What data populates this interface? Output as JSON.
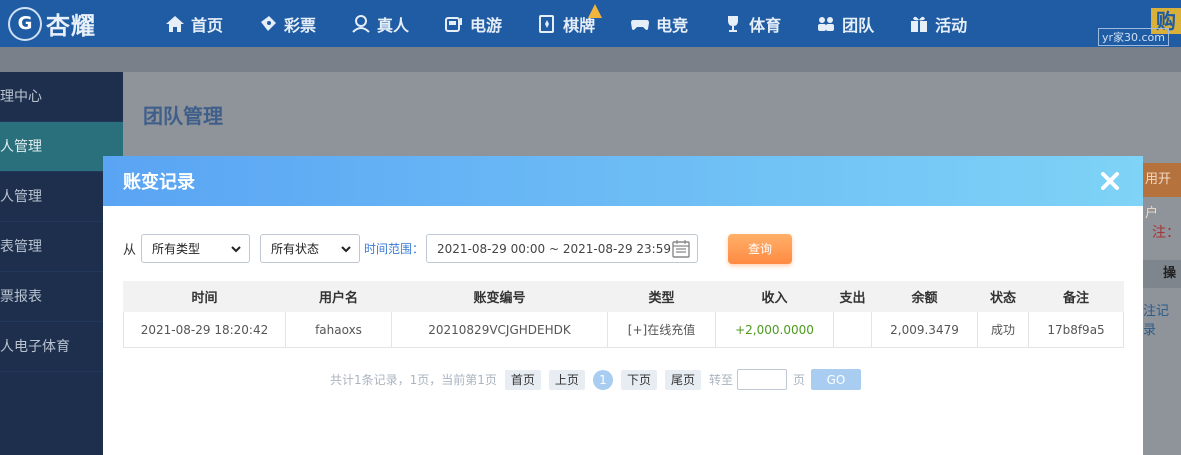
{
  "brand": {
    "logo_mark": "G",
    "name": "杏耀"
  },
  "nav": {
    "items": [
      {
        "label": "首页",
        "icon": "home-icon"
      },
      {
        "label": "彩票",
        "icon": "ticket-icon"
      },
      {
        "label": "真人",
        "icon": "person-icon"
      },
      {
        "label": "电游",
        "icon": "slot-machine-icon"
      },
      {
        "label": "棋牌",
        "icon": "card-icon"
      },
      {
        "label": "电竞",
        "icon": "gamepad-icon"
      },
      {
        "label": "体育",
        "icon": "trophy-icon"
      },
      {
        "label": "团队",
        "icon": "team-icon"
      },
      {
        "label": "活动",
        "icon": "gift-icon"
      }
    ],
    "watermark": "yr家30.com",
    "corner_glyph": "购"
  },
  "sidebar": {
    "items": [
      {
        "label": "理中心"
      },
      {
        "label": "人管理"
      },
      {
        "label": "人管理"
      },
      {
        "label": "表管理"
      },
      {
        "label": "票报表"
      },
      {
        "label": "人电子体育"
      }
    ]
  },
  "page": {
    "title": "团队管理",
    "peek_orange": "用开户",
    "peek_red": "注：",
    "peek_head": "操",
    "peek_link": "注记录"
  },
  "modal": {
    "title": "账变记录",
    "filters": {
      "from_label": "从",
      "type_select": "所有类型",
      "status_select": "所有状态",
      "range_label": "时间范围：",
      "range_value": "2021-08-29 00:00 ~ 2021-08-29 23:59",
      "query_label": "查询"
    },
    "table": {
      "columns": [
        "时间",
        "用户名",
        "账变编号",
        "类型",
        "收入",
        "支出",
        "余额",
        "状态",
        "备注"
      ],
      "rows": [
        {
          "time": "2021-08-29 18:20:42",
          "user": "fahaoxs",
          "txn_id": "20210829VCJGHDEHDK",
          "type": "[+]在线充值",
          "income": "+2,000.0000",
          "expense": "",
          "balance": "2,009.3479",
          "status": "成功",
          "remark": "17b8f9a5"
        }
      ]
    },
    "pager": {
      "info": "共计1条记录，1页，当前第1页",
      "first": "首页",
      "prev": "上页",
      "current": "1",
      "next": "下页",
      "last": "尾页",
      "goto_label": "转至",
      "page_unit": "页",
      "go": "GO"
    }
  },
  "colors": {
    "nav_bg": "#1f5ca3",
    "modal_header_from": "#5aa4f4",
    "modal_header_to": "#7ed3f6",
    "query_btn": "#ff8a42",
    "income_green": "#4c9a1d"
  }
}
